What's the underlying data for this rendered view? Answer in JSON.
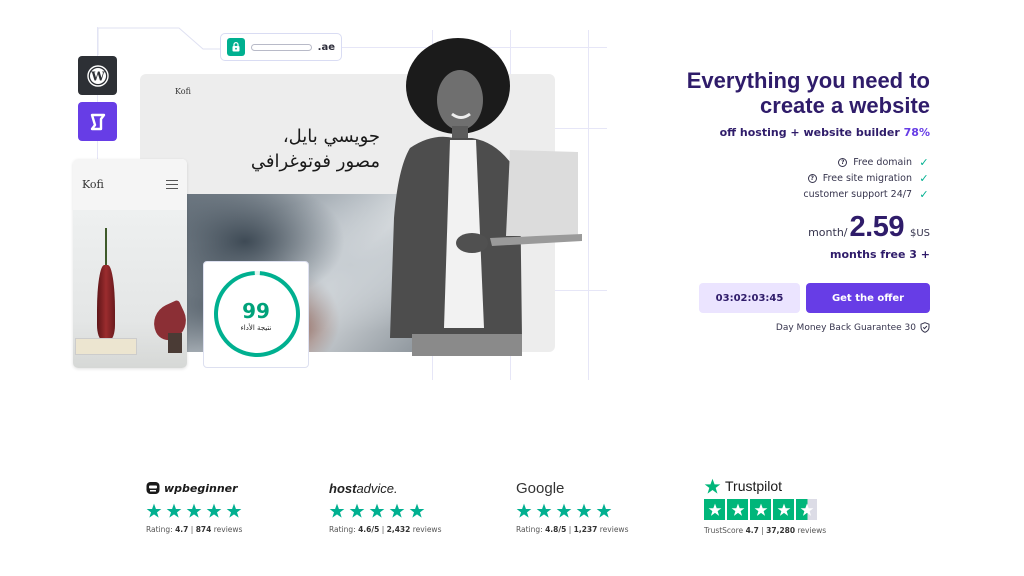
{
  "hero": {
    "url_tld": ".ae",
    "preview_brand": "Kofi",
    "preview_title_line1": "جويسي بايل،",
    "preview_title_line2": "مصور فوتوغرافي",
    "mobile_brand": "Kofi",
    "performance_score": "99",
    "performance_label": "نتيجة الأداء",
    "performance_fraction": 0.99,
    "app_icons": [
      "wordpress-icon",
      "hostinger-builder-icon"
    ]
  },
  "offer": {
    "headline_line1": "Everything you need to",
    "headline_line2": "create a website",
    "subline_text": "off hosting + website builder ",
    "subline_percent": "78%",
    "features": [
      {
        "label": "Free domain",
        "info_icon": true
      },
      {
        "label": "Free site migration",
        "info_icon": true
      },
      {
        "label": "customer support 24/7",
        "info_icon": false
      }
    ],
    "price_period": "month/",
    "price": "2.59",
    "currency": "$US",
    "bonus": "months free 3 +",
    "timer": "03:02:03:45",
    "cta_label": "Get the offer",
    "guarantee": "Day Money Back Guarantee 30"
  },
  "reviews": [
    {
      "brand": "wpbeginner",
      "rating_prefix": "Rating: ",
      "score": "4.7",
      "sep": " | ",
      "count": "874",
      "suffix": " reviews",
      "stars": 5
    },
    {
      "brand_bold": "host",
      "brand_light": "advice.",
      "rating_prefix": "Rating: ",
      "score": "4.6/5",
      "sep": " | ",
      "count": "2,432",
      "suffix": " reviews",
      "stars": 5
    },
    {
      "brand": "Google",
      "rating_prefix": "Rating: ",
      "score": "4.8/5",
      "sep": " | ",
      "count": "1,237",
      "suffix": " reviews",
      "stars": 5
    },
    {
      "brand": "Trustpilot",
      "rating_prefix": "TrustScore ",
      "score": "4.7",
      "sep": " | ",
      "count": "37,280",
      "suffix": " reviews",
      "stars": 4.5
    }
  ],
  "colors": {
    "brand_purple": "#673de6",
    "dark_navy": "#2f1c6a",
    "timer_bg": "#ebe4ff",
    "star_green": "#00b090",
    "trustpilot_green": "#00b67a"
  }
}
